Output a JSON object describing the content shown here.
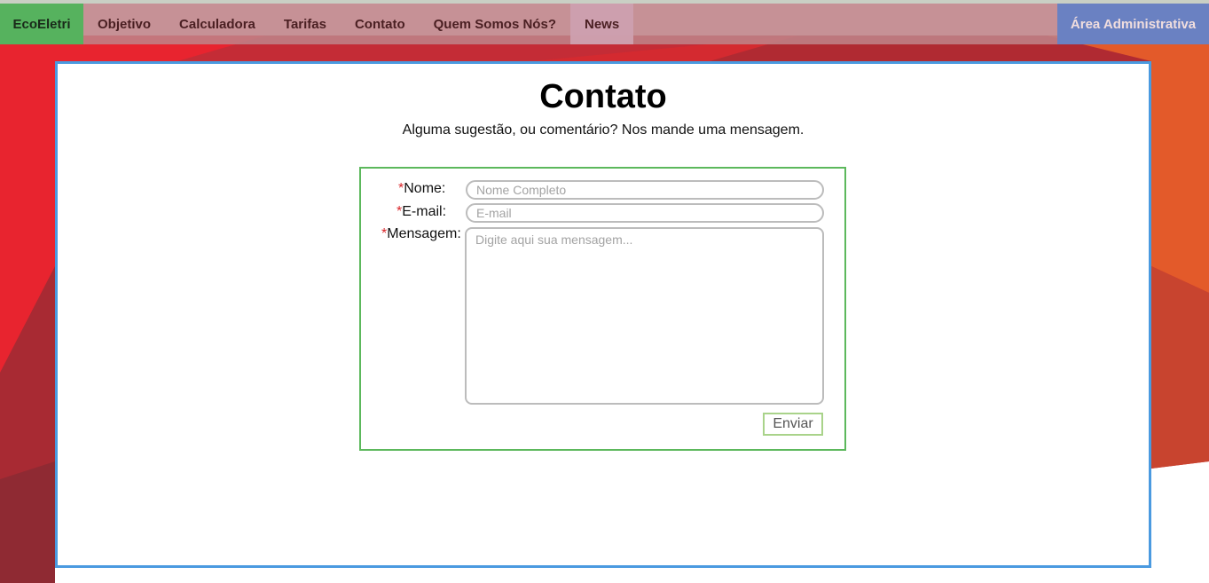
{
  "nav": {
    "brand": "EcoEletri",
    "items": [
      {
        "label": "Objetivo"
      },
      {
        "label": "Calculadora"
      },
      {
        "label": "Tarifas"
      },
      {
        "label": "Contato"
      },
      {
        "label": "Quem Somos Nós?"
      },
      {
        "label": "News"
      }
    ],
    "admin": "Área Administrativa"
  },
  "page": {
    "title": "Contato",
    "subtitle": "Alguma sugestão, ou comentário? Nos mande uma mensagem."
  },
  "form": {
    "required_mark": "*",
    "name_label": "Nome:",
    "name_placeholder": "Nome Completo",
    "email_label": "E-mail:",
    "email_placeholder": "E-mail",
    "message_label": "Mensagem:",
    "message_placeholder": "Digite aqui sua mensagem...",
    "submit_label": "Enviar"
  },
  "colors": {
    "brand_green": "#56b25e",
    "admin_blue": "#6a81c2",
    "panel_border": "#4a9ae0",
    "form_border": "#5cb85c",
    "required": "#d9262b"
  }
}
